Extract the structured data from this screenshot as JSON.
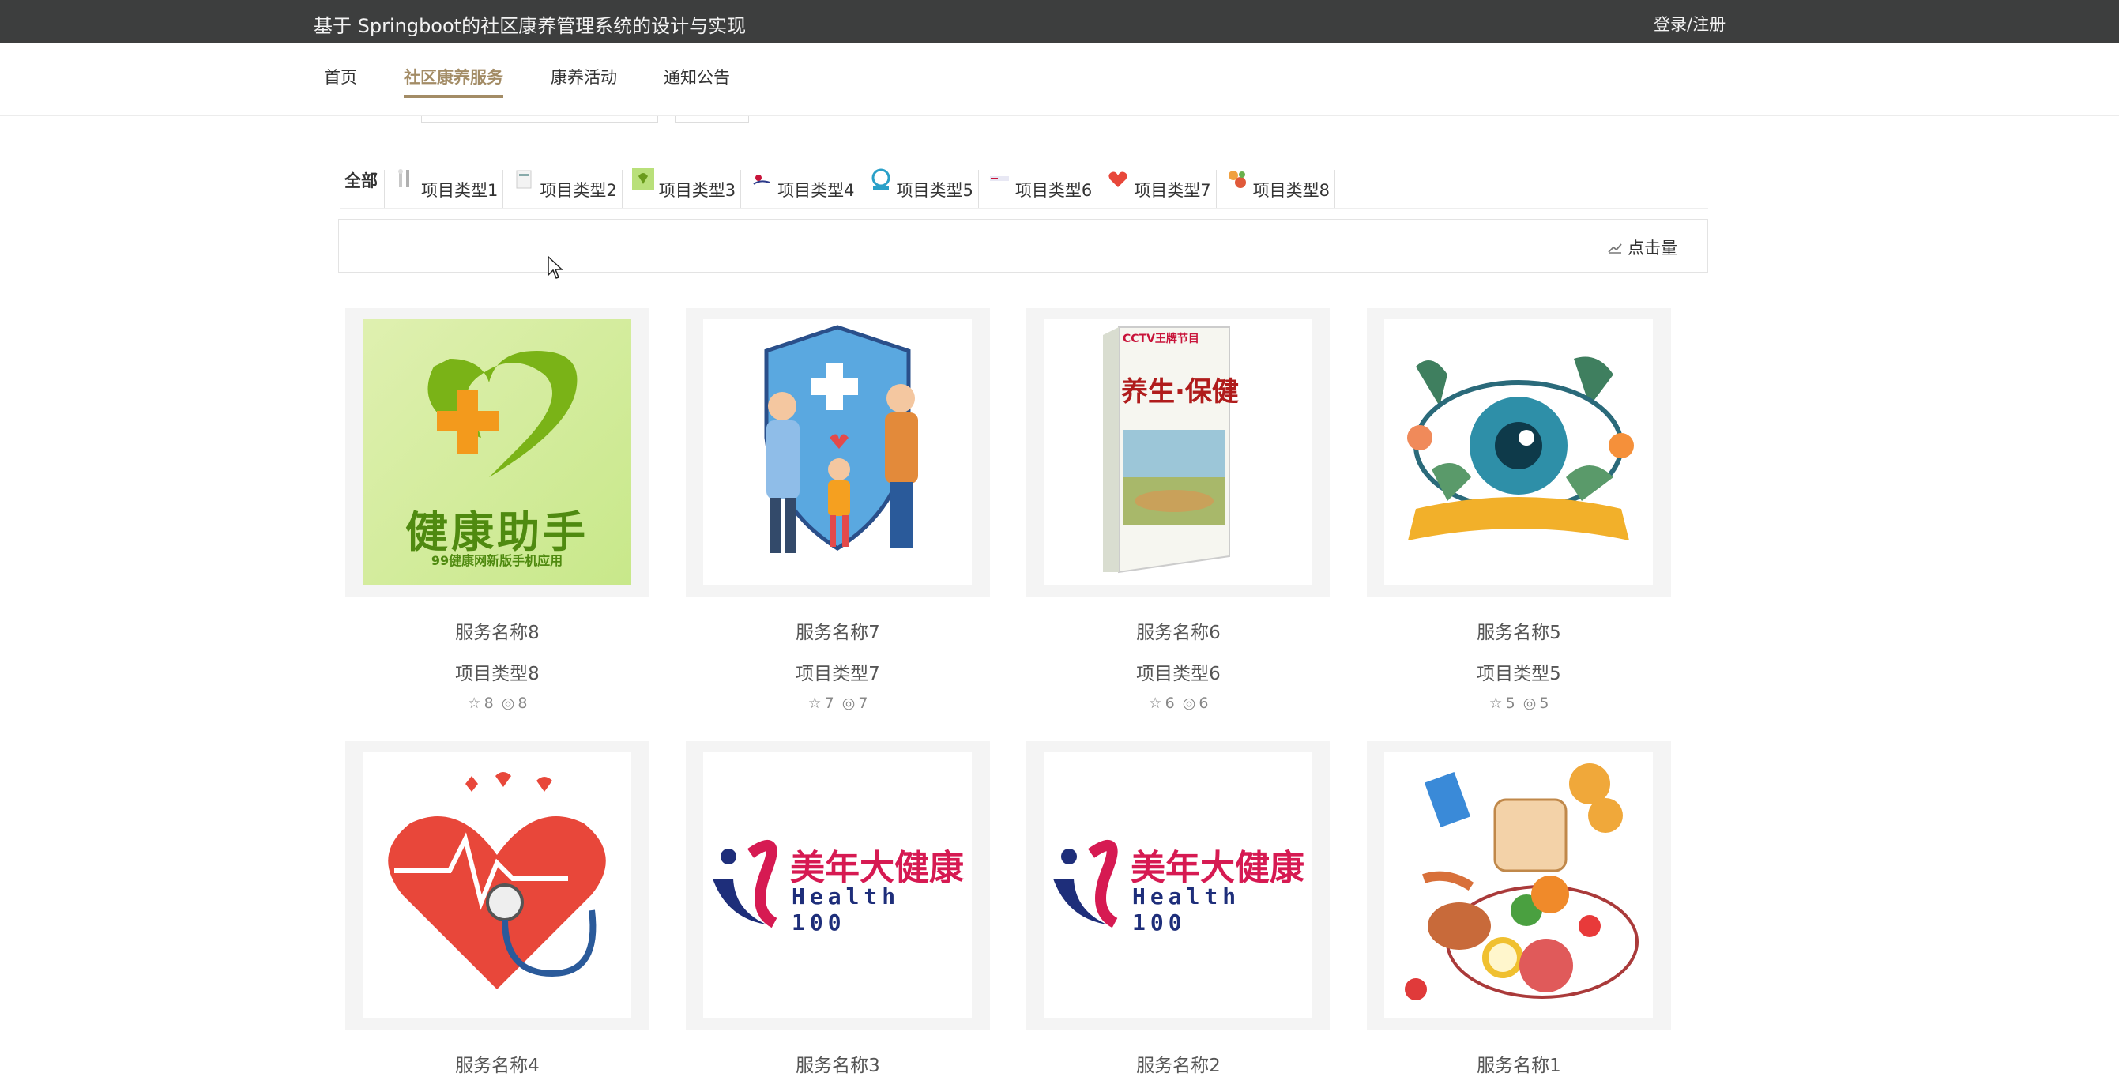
{
  "header": {
    "title": "基于 Springboot的社区康养管理系统的设计与实现",
    "login": "登录/注册"
  },
  "nav": [
    {
      "label": "首页",
      "active": false
    },
    {
      "label": "社区康养服务",
      "active": true
    },
    {
      "label": "康养活动",
      "active": false
    },
    {
      "label": "通知公告",
      "active": false
    }
  ],
  "types": {
    "all": "全部",
    "items": [
      {
        "label": "项目类型1"
      },
      {
        "label": "项目类型2"
      },
      {
        "label": "项目类型3"
      },
      {
        "label": "项目类型4"
      },
      {
        "label": "项目类型5"
      },
      {
        "label": "项目类型6"
      },
      {
        "label": "项目类型7"
      },
      {
        "label": "项目类型8"
      }
    ]
  },
  "sort": {
    "label": "点击量"
  },
  "cards": [
    {
      "name": "服务名称8",
      "type": "项目类型8",
      "likes": "8",
      "views": "8",
      "image_text": "健康助手",
      "image_subtext": "99健康网新版手机应用"
    },
    {
      "name": "服务名称7",
      "type": "项目类型7",
      "likes": "7",
      "views": "7"
    },
    {
      "name": "服务名称6",
      "type": "项目类型6",
      "likes": "6",
      "views": "6",
      "image_text": "养生·保健",
      "image_subtext": "CCTV王牌节目"
    },
    {
      "name": "服务名称5",
      "type": "项目类型5",
      "likes": "5",
      "views": "5"
    },
    {
      "name": "服务名称4"
    },
    {
      "name": "服务名称3",
      "image_text": "美年大健康",
      "image_subtext": "Health 100"
    },
    {
      "name": "服务名称2",
      "image_text": "美年大健康",
      "image_subtext": "Health 100"
    },
    {
      "name": "服务名称1"
    }
  ]
}
